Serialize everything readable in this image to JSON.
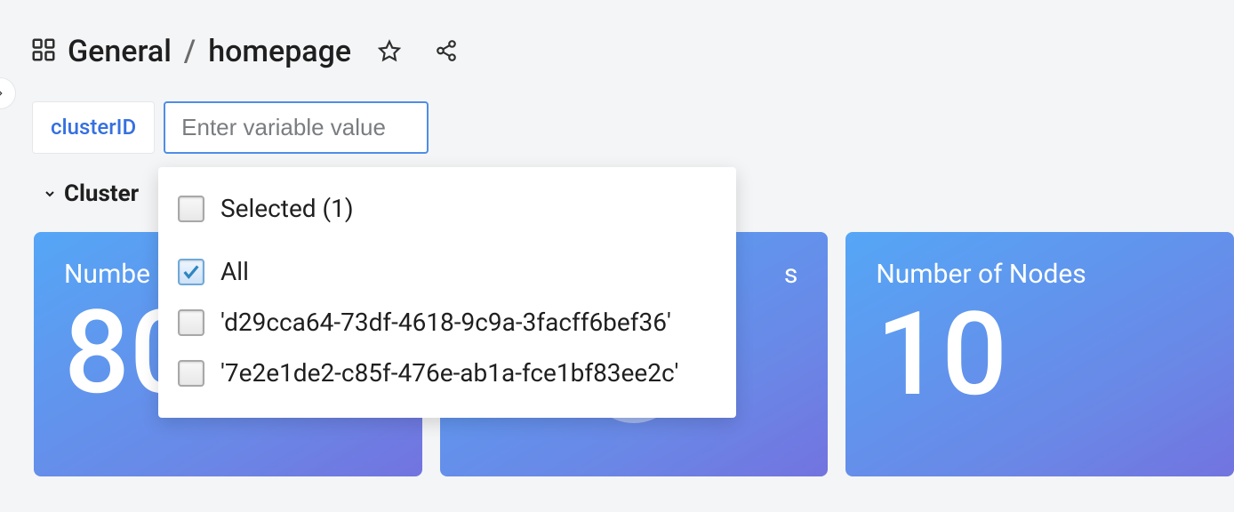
{
  "header": {
    "folder": "General",
    "page": "homepage"
  },
  "variable": {
    "label": "clusterID",
    "placeholder": "Enter variable value"
  },
  "section": {
    "title": "Cluster"
  },
  "dropdown": {
    "selected_label": "Selected (1)",
    "options": {
      "all": {
        "label": "All",
        "checked": true
      },
      "o1": {
        "label": "'d29cca64-73df-4618-9c9a-3facff6bef36'",
        "checked": false
      },
      "o2": {
        "label": "'7e2e1de2-c85f-476e-ab1a-fce1bf83ee2c'",
        "checked": false
      }
    }
  },
  "panels": {
    "a": {
      "title": "Numbe",
      "value": "80"
    },
    "b": {
      "partial_text": "s"
    },
    "c": {
      "title": "Number of Nodes",
      "value": "10"
    }
  }
}
